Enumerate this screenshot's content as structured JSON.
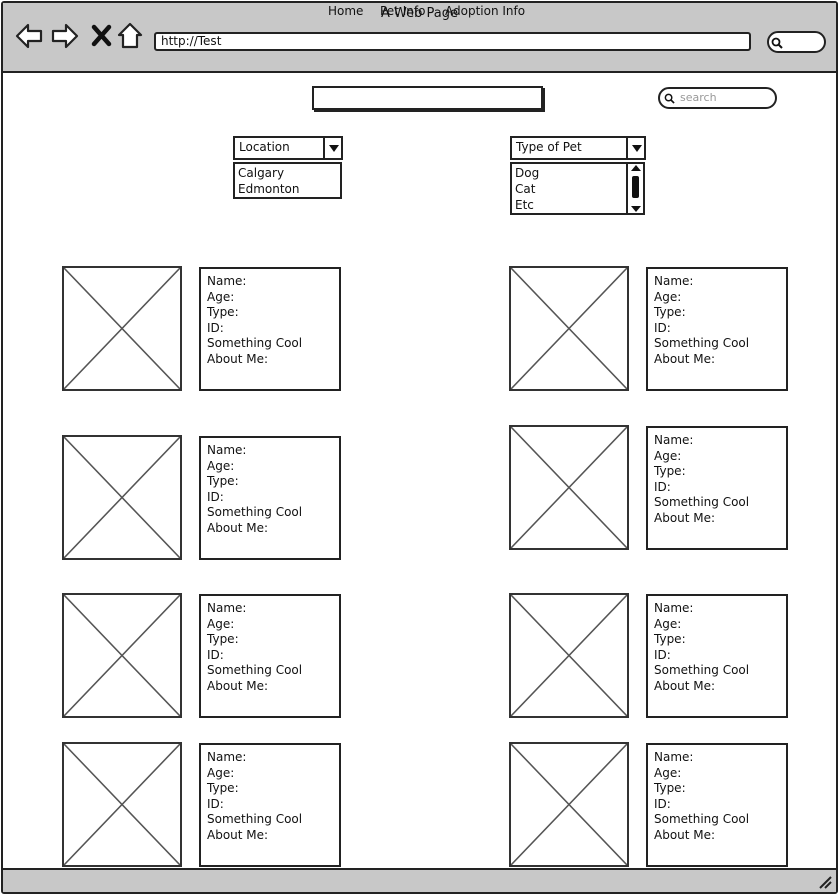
{
  "window": {
    "title": "A Web Page"
  },
  "browser": {
    "url": "http://Test",
    "icons": [
      "back-arrow-icon",
      "forward-arrow-icon",
      "stop-x-icon",
      "home-icon",
      "search-icon"
    ]
  },
  "nav": {
    "items": [
      "Home",
      "Pet Info",
      "Adoption Info"
    ]
  },
  "search": {
    "placeholder": "search"
  },
  "filters": {
    "location": {
      "label": "Location",
      "options": [
        "Calgary",
        "Edmonton"
      ]
    },
    "pet_type": {
      "label": "Type of Pet",
      "options": [
        "Dog",
        "Cat",
        "Etc"
      ]
    }
  },
  "cards": [
    {
      "fields": [
        "Name:",
        "Age:",
        "Type:",
        "ID:",
        "Something Cool",
        "About Me:"
      ]
    },
    {
      "fields": [
        "Name:",
        "Age:",
        "Type:",
        "ID:",
        "Something Cool",
        "About Me:"
      ]
    },
    {
      "fields": [
        "Name:",
        "Age:",
        "Type:",
        "ID:",
        "Something Cool",
        "About Me:"
      ]
    },
    {
      "fields": [
        "Name:",
        "Age:",
        "Type:",
        "ID:",
        "Something Cool",
        "About Me:"
      ]
    },
    {
      "fields": [
        "Name:",
        "Age:",
        "Type:",
        "ID:",
        "Something Cool",
        "About Me:"
      ]
    },
    {
      "fields": [
        "Name:",
        "Age:",
        "Type:",
        "ID:",
        "Something Cool",
        "About Me:"
      ]
    },
    {
      "fields": [
        "Name:",
        "Age:",
        "Type:",
        "ID:",
        "Something Cool",
        "About Me:"
      ]
    },
    {
      "fields": [
        "Name:",
        "Age:",
        "Type:",
        "ID:",
        "Something Cool",
        "About Me:"
      ]
    }
  ]
}
